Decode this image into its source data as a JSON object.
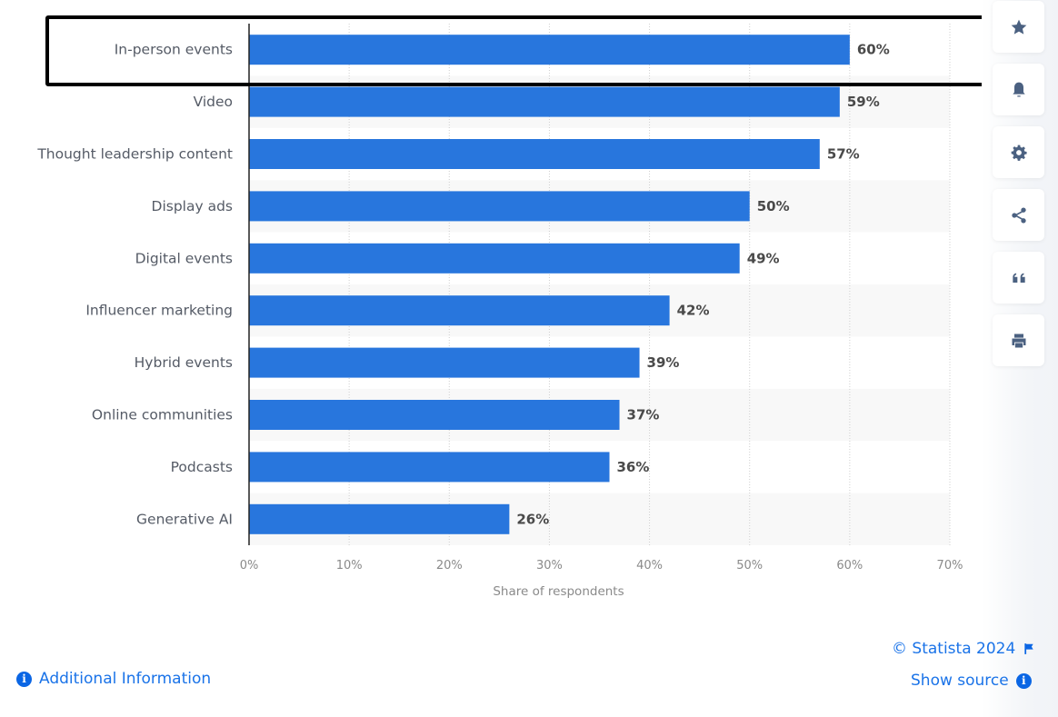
{
  "chart_data": {
    "type": "bar",
    "orientation": "horizontal",
    "categories": [
      "In-person events",
      "Video",
      "Thought leadership content",
      "Display ads",
      "Digital events",
      "Influencer marketing",
      "Hybrid events",
      "Online communities",
      "Podcasts",
      "Generative AI"
    ],
    "values": [
      60,
      59,
      57,
      50,
      49,
      42,
      39,
      37,
      36,
      26
    ],
    "value_labels": [
      "60%",
      "59%",
      "57%",
      "50%",
      "49%",
      "42%",
      "39%",
      "37%",
      "36%",
      "26%"
    ],
    "title": "",
    "xlabel": "Share of respondents",
    "ylabel": "",
    "xlim": [
      0,
      70
    ],
    "x_ticks": [
      0,
      10,
      20,
      30,
      40,
      50,
      60,
      70
    ],
    "x_tick_labels": [
      "0%",
      "10%",
      "20%",
      "30%",
      "40%",
      "50%",
      "60%",
      "70%"
    ],
    "grid": true,
    "bar_color": "#2876dd",
    "highlighted_category": "In-person events"
  },
  "sidebar": {
    "buttons": [
      {
        "name": "favorite",
        "icon": "star-icon"
      },
      {
        "name": "notification",
        "icon": "bell-icon"
      },
      {
        "name": "settings",
        "icon": "gear-icon"
      },
      {
        "name": "share",
        "icon": "share-icon"
      },
      {
        "name": "cite",
        "icon": "quote-icon"
      },
      {
        "name": "print",
        "icon": "print-icon"
      }
    ]
  },
  "footer": {
    "additional_info": "Additional Information",
    "copyright": "© Statista 2024",
    "show_source": "Show source"
  },
  "colors": {
    "accent": "#1a73e8",
    "icon": "#4b6181"
  }
}
